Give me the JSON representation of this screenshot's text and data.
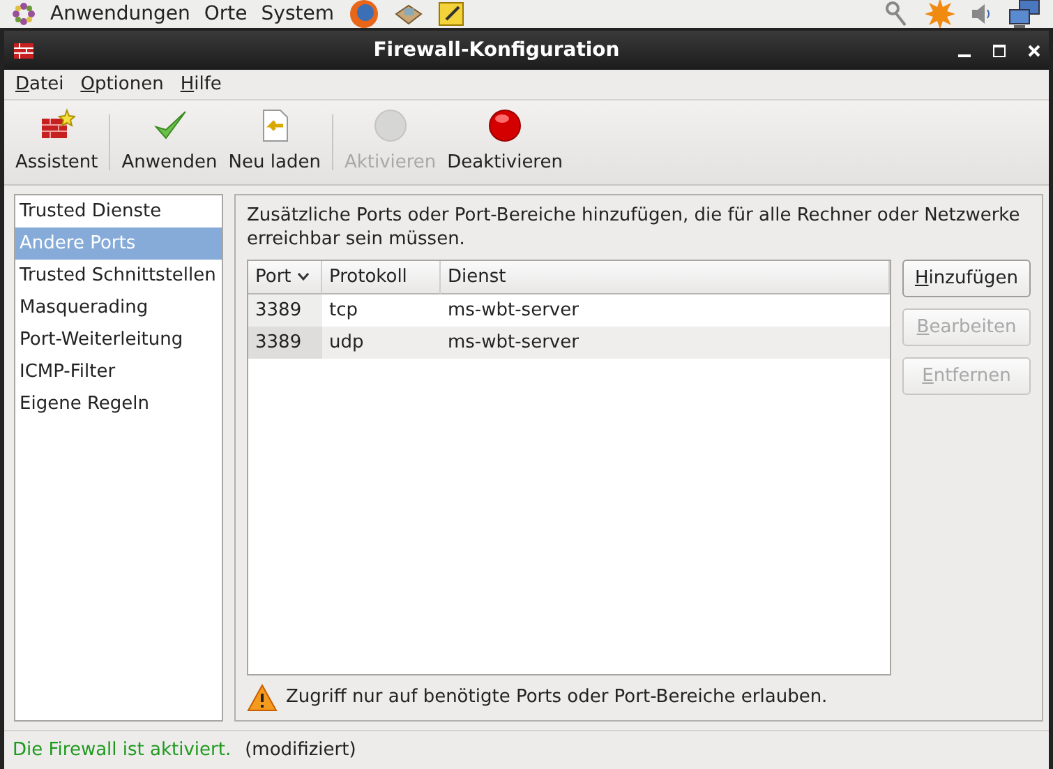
{
  "top_panel": {
    "menus": [
      "Anwendungen",
      "Orte",
      "System"
    ]
  },
  "window": {
    "title": "Firewall-Konfiguration"
  },
  "menubar": [
    {
      "label": "Datei",
      "mnemonic": true
    },
    {
      "label": "Optionen",
      "mnemonic": true
    },
    {
      "label": "Hilfe",
      "mnemonic": true
    }
  ],
  "toolbar": [
    {
      "label": "Assistent",
      "kind": "wizard",
      "disabled": false
    },
    {
      "kind": "separator"
    },
    {
      "label": "Anwenden",
      "kind": "check",
      "disabled": false
    },
    {
      "label": "Neu laden",
      "kind": "reload",
      "disabled": false
    },
    {
      "kind": "separator"
    },
    {
      "label": "Aktivieren",
      "kind": "dot",
      "disabled": true
    },
    {
      "label": "Deaktivieren",
      "kind": "dot",
      "disabled": false
    }
  ],
  "sidebar": {
    "items": [
      {
        "label": "Trusted Dienste",
        "selected": false
      },
      {
        "label": "Andere Ports",
        "selected": true
      },
      {
        "label": "Trusted Schnittstellen",
        "selected": false
      },
      {
        "label": "Masquerading",
        "selected": false
      },
      {
        "label": "Port-Weiterleitung",
        "selected": false
      },
      {
        "label": "ICMP-Filter",
        "selected": false
      },
      {
        "label": "Eigene Regeln",
        "selected": false
      }
    ]
  },
  "content": {
    "description": "Zusätzliche Ports oder Port-Bereiche hinzufügen, die für alle Rechner oder Netzwerke erreichbar sein müssen.",
    "table": {
      "columns": [
        {
          "label": "Port",
          "sorted": true
        },
        {
          "label": "Protokoll",
          "sorted": false
        },
        {
          "label": "Dienst",
          "sorted": false
        }
      ],
      "rows": [
        [
          "3389",
          "tcp",
          "ms-wbt-server"
        ],
        [
          "3389",
          "udp",
          "ms-wbt-server"
        ]
      ]
    },
    "buttons": [
      {
        "label": "Hinzufügen",
        "disabled": false
      },
      {
        "label": "Bearbeiten",
        "disabled": true
      },
      {
        "label": "Entfernen",
        "disabled": true
      }
    ],
    "warning": "Zugriff nur auf benötigte Ports oder Port-Bereiche erlauben."
  },
  "status_bar": {
    "status": "Die Firewall ist aktiviert.",
    "enabled": true,
    "note": "(modifiziert)"
  }
}
